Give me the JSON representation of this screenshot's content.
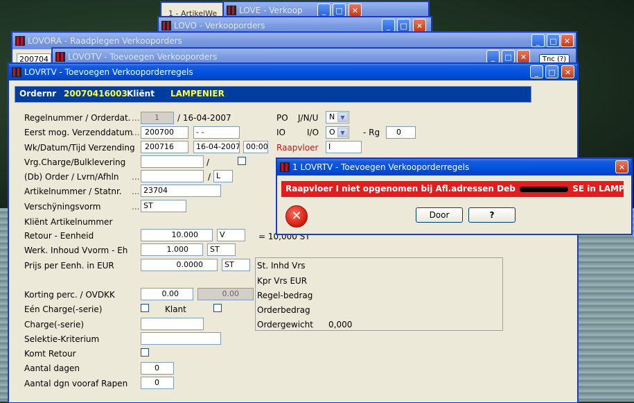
{
  "background_windows": {
    "w1": {
      "title": "1 - ArtikelWe"
    },
    "w2": {
      "title": "LOVE - Verkoop"
    },
    "w3": {
      "title": "LOVO - Verkooporders"
    },
    "w4": {
      "title": "LOVORA - Raadplegen Verkooporders",
      "field_value": "200704"
    },
    "w5": {
      "title": "LOVOTV - Toevoegen Verkooporders",
      "side_btn": "Tnc (?)"
    }
  },
  "main": {
    "title": "LOVRTV - Toevoegen Verkooporderregels",
    "header": {
      "ordernr_label": "Ordernr",
      "ordernr_value": "20070416003",
      "klient_label": "Kliënt",
      "klient_value": "LAMPENIER"
    },
    "rows": {
      "regelnummer": {
        "label": "Regelnummer / Orderdat.",
        "value": "1",
        "date": "/ 16-04-2007"
      },
      "eerst": {
        "label": "Eerst mog. Verzenddatum",
        "value": "200700",
        "extra": " -  -"
      },
      "wk": {
        "label": "Wk/Datum/Tijd Verzending",
        "value": "200716",
        "date": "16-04-2007",
        "time": "00:00"
      },
      "vrg": {
        "label": "Vrg.Charge/Bulklevering",
        "sep": "/"
      },
      "db": {
        "label": "(Db) Order / Lvrn/Afhln",
        "sep": "/",
        "value": "L"
      },
      "artikel": {
        "label": "Artikelnummer / Statnr.",
        "value": "23704"
      },
      "versch": {
        "label": "Verschÿningsvorm",
        "value": "ST"
      },
      "klientart": {
        "label": "Kliënt Artikelnummer"
      },
      "retour": {
        "label": "Retour - Eenheid",
        "value": "10.000",
        "unit": "V",
        "eq": "= 10,000 ST"
      },
      "werk": {
        "label": "Werk. Inhoud Vvorm - Eh",
        "value": "1.000",
        "unit": "ST"
      },
      "prijs": {
        "label": "Prijs per Eenh. in EUR",
        "value": "0.0000",
        "unit": "ST"
      },
      "korting": {
        "label": "Korting perc. / OVDKK",
        "value": "0.00",
        "value2": "0.00"
      },
      "een": {
        "label": "Eén Charge(-serie)",
        "klant": "Klant"
      },
      "charge": {
        "label": "Charge(-serie)"
      },
      "selektie": {
        "label": "Selektie-Kriterium"
      },
      "komt": {
        "label": "Komt Retour"
      },
      "aantal": {
        "label": "Aantal dagen",
        "value": "0"
      },
      "aantalrapen": {
        "label": "Aantal dgn vooraf Rapen",
        "value": "0"
      }
    },
    "right": {
      "po_label": "PO",
      "jnu_label": "J/N/U",
      "jnu_value": "N",
      "io_label": "IO",
      "io2_label": "I/O",
      "io_value": "O",
      "rg_label": "- Rg",
      "rg_value": "0",
      "raapvloer_label": "Raapvloer",
      "raapvloer_value": "I"
    },
    "info": {
      "st_label": "St. Inhd Vrs",
      "kpr_label": "Kpr Vrs  EUR",
      "regel_label": "Regel-bedrag",
      "order_label": "Orderbedrag",
      "gewicht_label": "Ordergewicht",
      "gewicht_value": "0,000"
    },
    "dots": "..."
  },
  "dialog": {
    "title": "1 LOVRTV - Toevoegen Verkooporderregels",
    "message": "Raapvloer  I niet opgenomen bij Afl.adressen Deb",
    "message_tail": "SE in LAMPENIER",
    "door_label": "Door",
    "help_label": "?",
    "message_color": "#e01e1e"
  }
}
